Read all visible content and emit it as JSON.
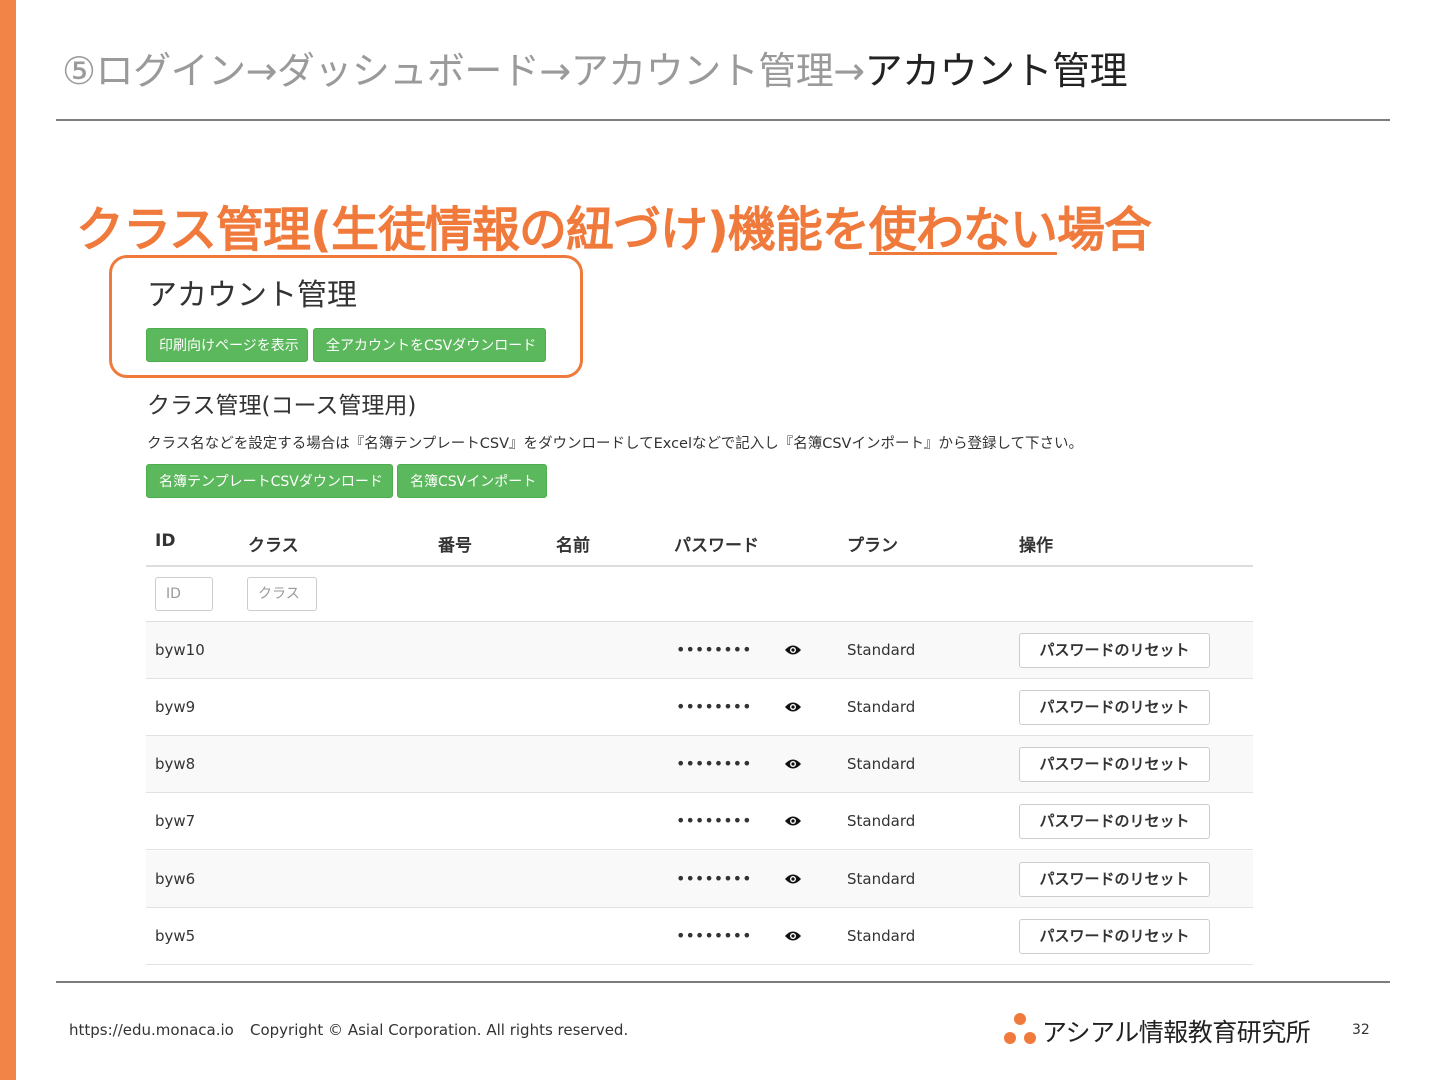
{
  "slide": {
    "breadcrumb_muted": "⑤ログイン→ダッシュボード→アカウント管理→",
    "breadcrumb_current": "アカウント管理",
    "headline_pre": "クラス管理(生徒情報の紐づけ)機能を",
    "headline_underline": "使わない",
    "headline_post": "場合"
  },
  "account": {
    "title": "アカウント管理",
    "buttons": {
      "print": "印刷向けページを表示",
      "csv_download_all": "全アカウントをCSVダウンロード"
    }
  },
  "class_section": {
    "title": "クラス管理(コース管理用)",
    "description": "クラス名などを設定する場合は『名簿テンプレートCSV』をダウンロードしてExcelなどで記入し『名簿CSVインポート』から登録して下さい。",
    "buttons": {
      "template_download": "名簿テンプレートCSVダウンロード",
      "csv_import": "名簿CSVインポート"
    }
  },
  "table": {
    "headers": {
      "id": "ID",
      "class": "クラス",
      "number": "番号",
      "name": "名前",
      "password": "パスワード",
      "plan": "プラン",
      "actions": "操作"
    },
    "filters": {
      "id_placeholder": "ID",
      "class_placeholder": "クラス"
    },
    "reset_label": "パスワードのリセット",
    "rows": [
      {
        "id": "byw10",
        "password": "••••••••",
        "plan": "Standard"
      },
      {
        "id": "byw9",
        "password": "••••••••",
        "plan": "Standard"
      },
      {
        "id": "byw8",
        "password": "••••••••",
        "plan": "Standard"
      },
      {
        "id": "byw7",
        "password": "••••••••",
        "plan": "Standard"
      },
      {
        "id": "byw6",
        "password": "••••••••",
        "plan": "Standard"
      },
      {
        "id": "byw5",
        "password": "••••••••",
        "plan": "Standard"
      }
    ]
  },
  "footer": {
    "url": "https://edu.monaca.io",
    "copyright": "Copyright © Asial Corporation. All rights reserved.",
    "brand": "アシアル情報教育研究所",
    "page_number": "32"
  },
  "colors": {
    "accent_orange": "#f07a3c",
    "button_green": "#5cb85c"
  },
  "icons": {
    "eye": "eye-icon",
    "logo": "logo-dots-icon"
  }
}
